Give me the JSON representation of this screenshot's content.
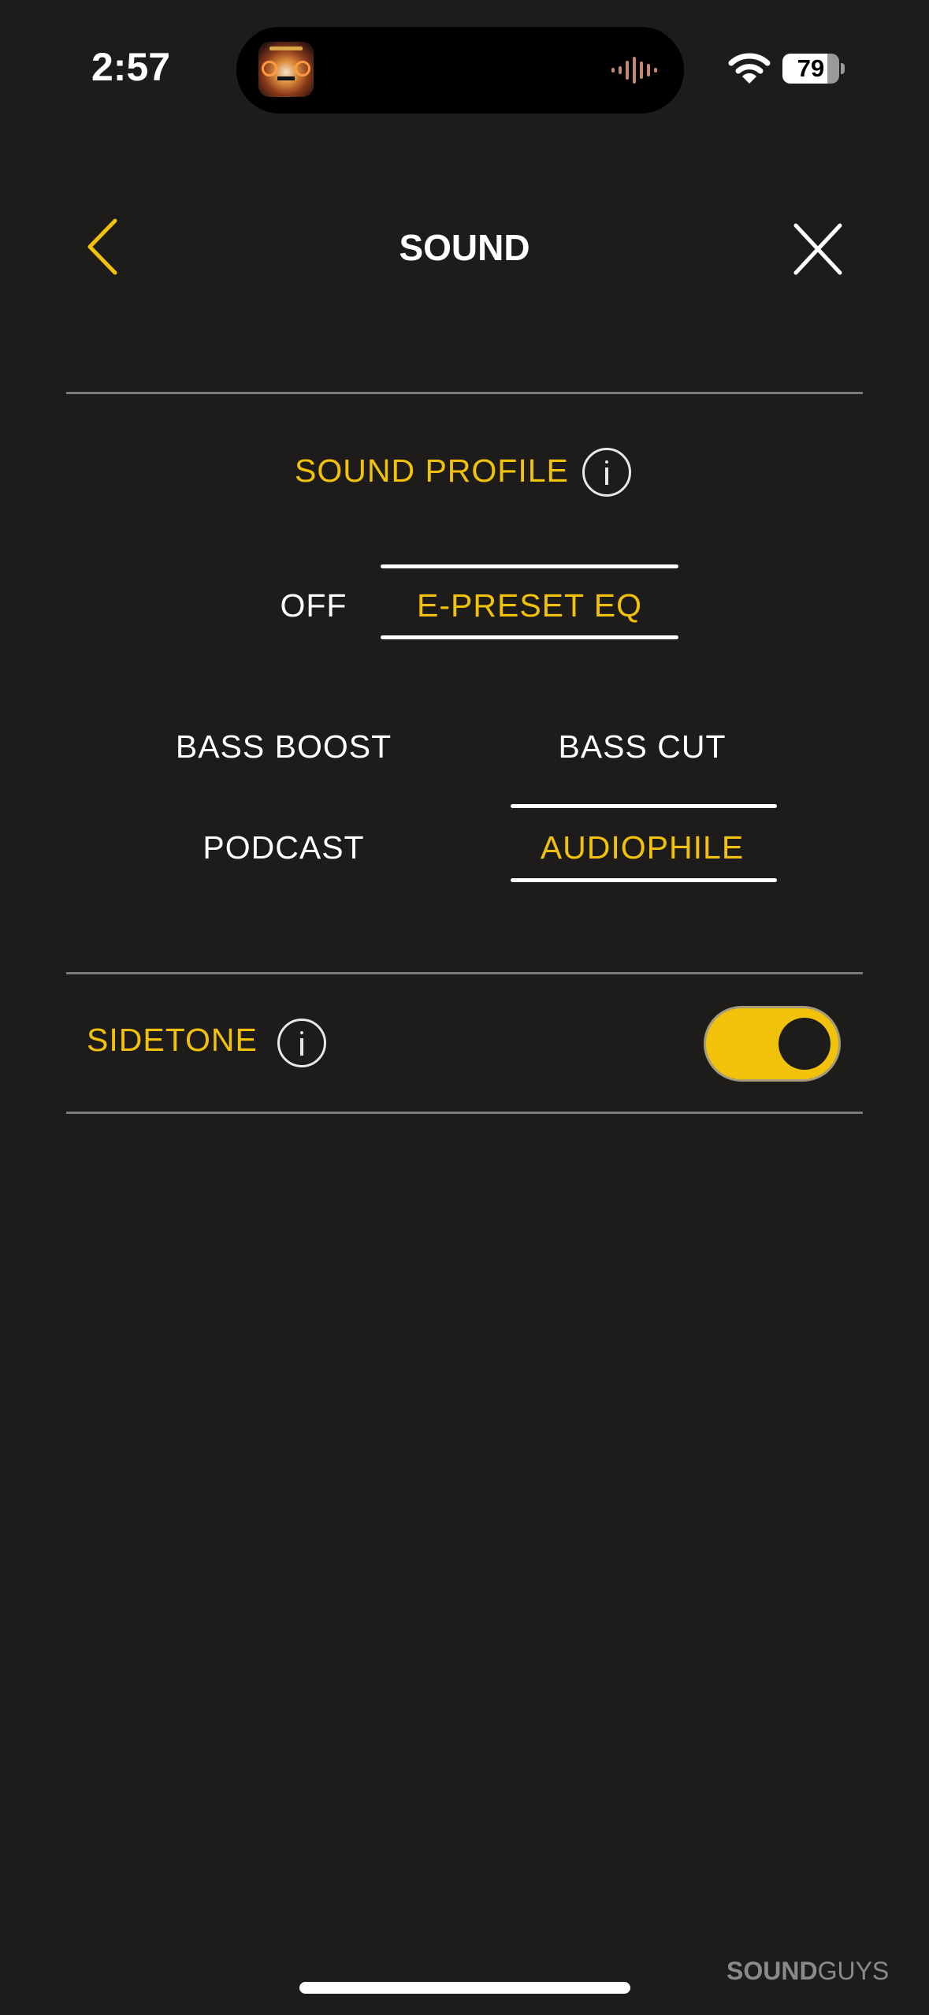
{
  "status_bar": {
    "time": "2:57",
    "battery_percent": "79",
    "wifi_icon": "wifi-icon",
    "now_playing_icon": "waveform-icon"
  },
  "header": {
    "title": "SOUND",
    "back_icon": "chevron-left-icon",
    "close_icon": "close-icon"
  },
  "sound_profile": {
    "title": "SOUND PROFILE",
    "info_icon": "info-icon",
    "modes": [
      {
        "label": "OFF",
        "selected": false
      },
      {
        "label": "E-PRESET EQ",
        "selected": true
      }
    ],
    "presets": [
      {
        "label": "BASS BOOST",
        "selected": false
      },
      {
        "label": "BASS CUT",
        "selected": false
      },
      {
        "label": "PODCAST",
        "selected": false
      },
      {
        "label": "AUDIOPHILE",
        "selected": true
      }
    ]
  },
  "sidetone": {
    "label": "SIDETONE",
    "info_icon": "info-icon",
    "enabled": true
  },
  "watermark": {
    "bold": "SOUND",
    "light": "GUYS"
  },
  "colors": {
    "accent": "#f2c20a",
    "background": "#1d1c1b",
    "divider": "#7b7b79"
  }
}
